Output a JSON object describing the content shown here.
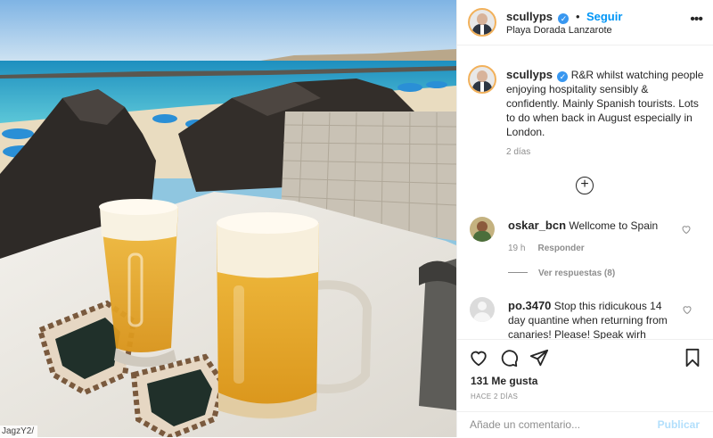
{
  "post": {
    "username": "scullyps",
    "verified": true,
    "follow_label": "Seguir",
    "separator": "•",
    "location": "Playa Dorada Lanzarote",
    "more_icon": "ellipsis-icon",
    "caption": "R&R whilst watching people enjoying hospitality sensibly & confidently. Mainly Spanish tourists. Lots to do when back in August especially in London.",
    "caption_time": "2 días",
    "load_more_icon": "plus-circle-icon"
  },
  "comments": [
    {
      "username": "oskar_bcn",
      "text": "Wellcome to Spain",
      "time": "19 h",
      "reply_label": "Responder",
      "view_replies": "Ver respuestas (8)"
    },
    {
      "username": "po.3470",
      "text": "Stop this ridicukous 14 day quantine when returning from canaries! Please! Speak wirh"
    }
  ],
  "actions": {
    "like_icon": "heart-icon",
    "comment_icon": "comment-icon",
    "share_icon": "paper-plane-icon",
    "save_icon": "bookmark-icon"
  },
  "likes": "131 Me gusta",
  "date": "HACE 2 DÍAS",
  "comment_box": {
    "placeholder": "Añade un comentario...",
    "post_label": "Publicar"
  },
  "photo": {
    "url_fragment": "JagzY2/"
  },
  "colors": {
    "link_blue": "#0095f6",
    "disabled_blue": "#b2dffc",
    "verified_blue": "#3897f0",
    "muted_text": "#8e8e8e",
    "primary_text": "#262626"
  }
}
